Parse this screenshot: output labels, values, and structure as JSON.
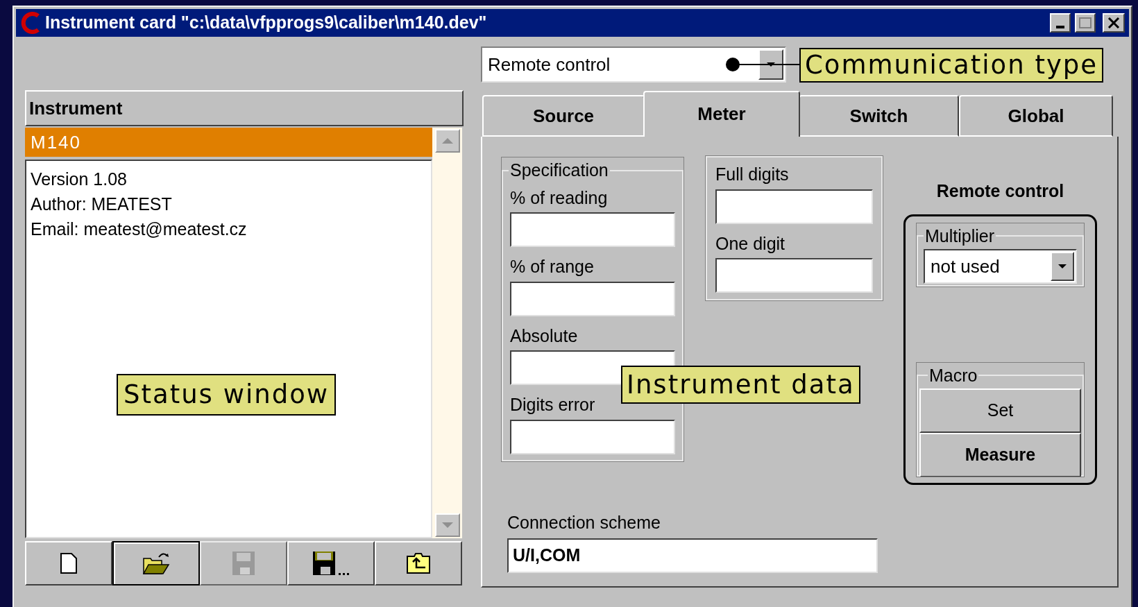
{
  "window": {
    "title": "Instrument card \"c:\\data\\vfpprogs9\\caliber\\m140.dev\""
  },
  "instrument_panel": {
    "header": "Instrument",
    "items": [
      {
        "label": "M140",
        "selected": true
      }
    ],
    "status_lines": [
      "Version 1.08",
      "Author: MEATEST",
      "Email: meatest@meatest.cz"
    ],
    "status_callout": "Status window",
    "toolbar": [
      {
        "kind": "new",
        "pressed": false,
        "disabled": false
      },
      {
        "kind": "open",
        "pressed": true,
        "disabled": false
      },
      {
        "kind": "save",
        "pressed": false,
        "disabled": true
      },
      {
        "kind": "save_as",
        "pressed": false,
        "disabled": false
      },
      {
        "kind": "export",
        "pressed": false,
        "disabled": false
      }
    ]
  },
  "communication": {
    "value": "Remote control",
    "callout": "Communication type"
  },
  "tabs": [
    {
      "label": "Source",
      "selected": false
    },
    {
      "label": "Meter",
      "selected": true
    },
    {
      "label": "Switch",
      "selected": false
    },
    {
      "label": "Global",
      "selected": false
    }
  ],
  "meter": {
    "specification": {
      "title": "Specification",
      "fields": [
        "% of reading",
        "% of range",
        "Absolute",
        "Digits error"
      ]
    },
    "digits": {
      "fields": [
        "Full digits",
        "One digit"
      ]
    },
    "remote": {
      "title": "Remote control",
      "multiplier": {
        "title": "Multiplier",
        "value": "not used"
      },
      "macro": {
        "title": "Macro",
        "buttons": [
          {
            "label": "Set",
            "default": false
          },
          {
            "label": "Measure",
            "default": true
          }
        ]
      }
    },
    "callout": "Instrument data",
    "connection": {
      "label": "Connection scheme",
      "value": "U/I,COM"
    }
  }
}
